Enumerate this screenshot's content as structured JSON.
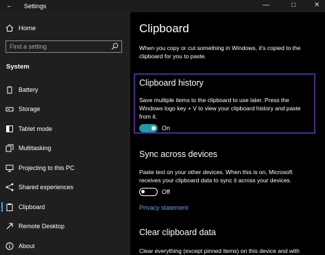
{
  "window": {
    "title": "Settings"
  },
  "sidebar": {
    "home_label": "Home",
    "search_placeholder": "Find a setting",
    "section_label": "System",
    "items": [
      {
        "label": "Battery",
        "icon": "battery-icon"
      },
      {
        "label": "Storage",
        "icon": "storage-icon"
      },
      {
        "label": "Tablet mode",
        "icon": "tablet-mode-icon"
      },
      {
        "label": "Multitasking",
        "icon": "multitasking-icon"
      },
      {
        "label": "Projecting to this PC",
        "icon": "projecting-icon"
      },
      {
        "label": "Shared experiences",
        "icon": "shared-experiences-icon"
      },
      {
        "label": "Clipboard",
        "icon": "clipboard-icon",
        "active": true
      },
      {
        "label": "Remote Desktop",
        "icon": "remote-desktop-icon"
      },
      {
        "label": "About",
        "icon": "about-icon"
      }
    ],
    "accent_color": "#4c9ee8"
  },
  "main": {
    "title": "Clipboard",
    "intro_line1": "When you copy or cut something in Windows, it's copied to the",
    "intro_line2": "clipboard for you to paste.",
    "history": {
      "heading": "Clipboard history",
      "desc_line1": "Save multiple items to the clipboard to use later. Press the",
      "desc_line2": "Windows logo key + V to view your clipboard history and paste",
      "desc_line3": "from it.",
      "toggle_state": "On",
      "toggle_color": "#1f9aa8",
      "highlight_color": "#4f2a8a"
    },
    "sync": {
      "heading": "Sync across devices",
      "desc_line1": "Paste text on your other devices. When this is on, Microsoft",
      "desc_line2": "receives your clipboard data to sync it across your devices.",
      "toggle_state": "Off",
      "link_label": "Privacy statement"
    },
    "clear": {
      "heading": "Clear clipboard data",
      "desc_line1": "Clear everything (except pinned items) on this device and with"
    }
  }
}
